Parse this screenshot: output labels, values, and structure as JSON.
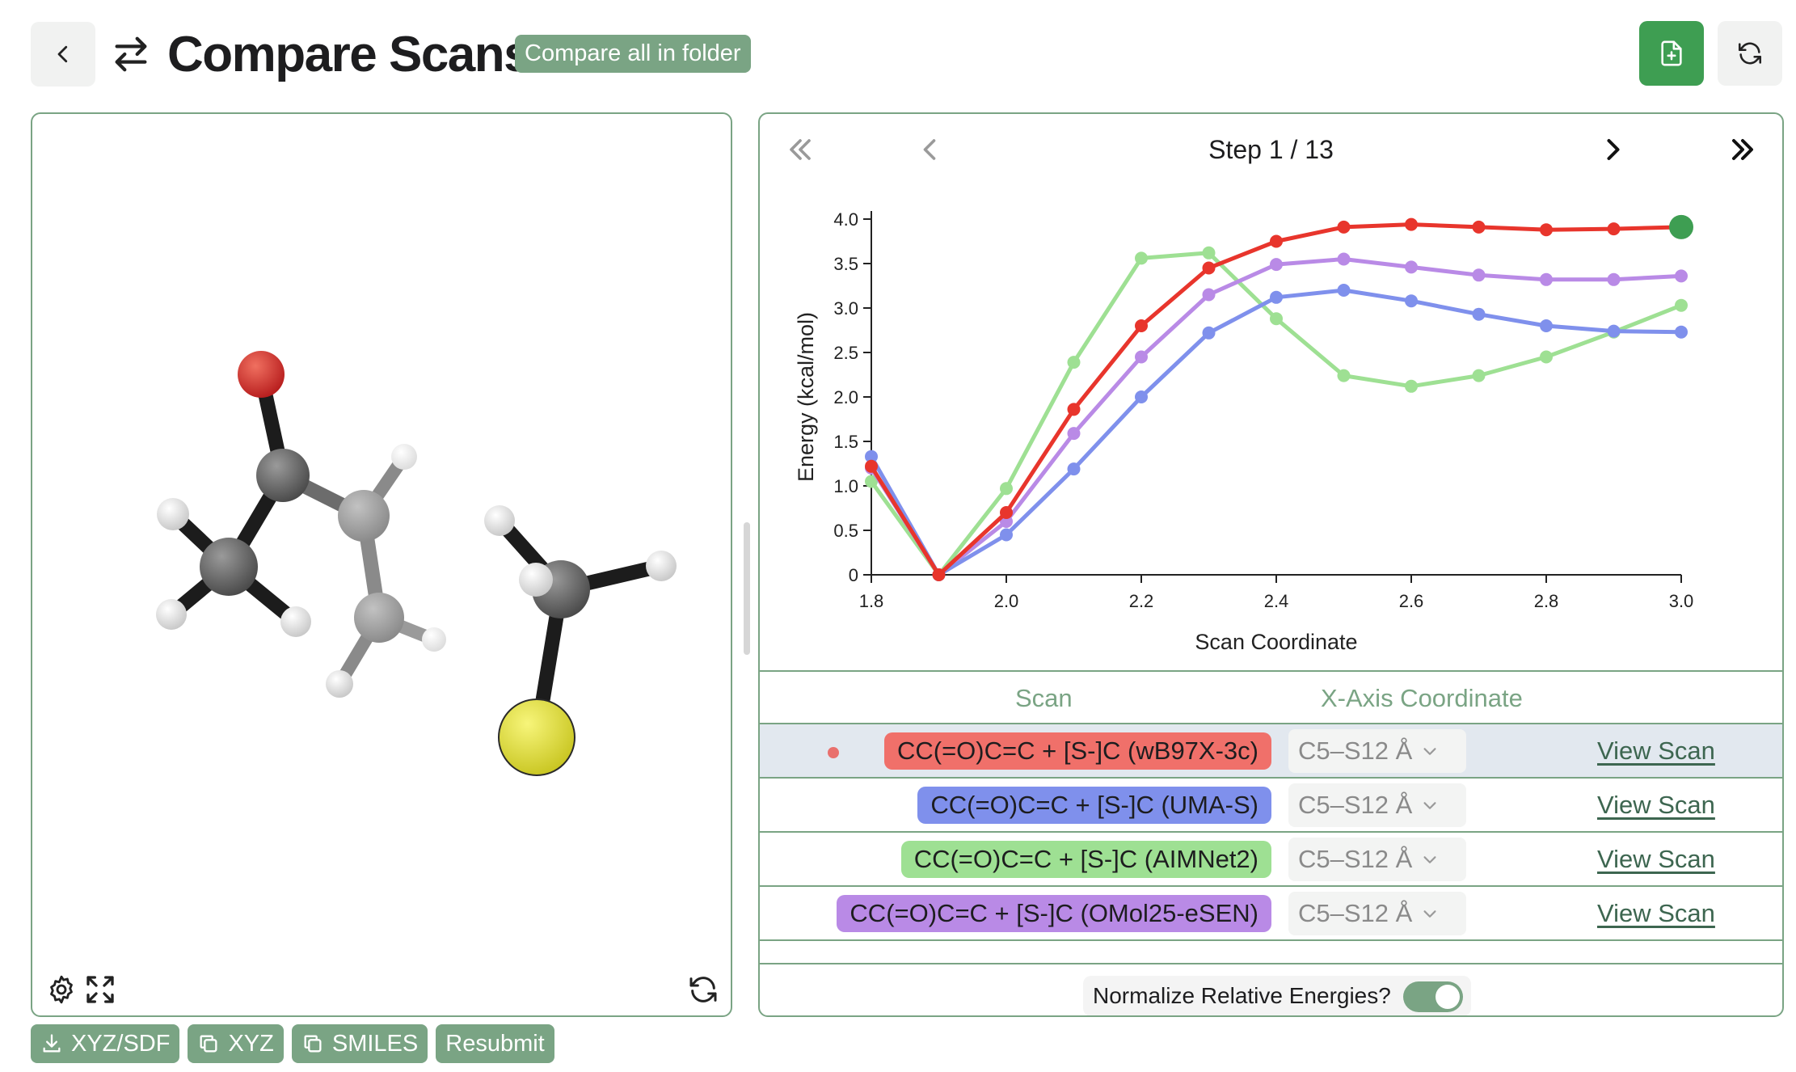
{
  "header": {
    "title": "Compare Scans",
    "folder_button": "Compare all in folder",
    "icons": [
      "chevron-left-icon",
      "swap-arrows-icon",
      "file-plus-icon",
      "refresh-icon"
    ]
  },
  "viewer": {
    "actions": [
      {
        "label": "XYZ/SDF",
        "icon": "download-icon"
      },
      {
        "label": "XYZ",
        "icon": "copy-icon"
      },
      {
        "label": "SMILES",
        "icon": "copy-icon"
      },
      {
        "label": "Resubmit",
        "icon": ""
      }
    ]
  },
  "stepper": {
    "label": "Step 1 / 13",
    "current_step": 1,
    "total_steps": 13
  },
  "chart_data": {
    "type": "line",
    "xlabel": "Scan Coordinate",
    "ylabel": "Energy (kcal/mol)",
    "xlim": [
      1.8,
      3.0
    ],
    "ylim": [
      0,
      4.0
    ],
    "x_ticks": [
      "1.8",
      "2.0",
      "2.2",
      "2.4",
      "2.6",
      "2.8",
      "3.0"
    ],
    "y_ticks": [
      "0",
      "0.5",
      "1.0",
      "1.5",
      "2.0",
      "2.5",
      "3.0",
      "3.5",
      "4.0"
    ],
    "x": [
      1.8,
      1.9,
      2.0,
      2.1,
      2.2,
      2.3,
      2.4,
      2.5,
      2.6,
      2.7,
      2.8,
      2.9,
      3.0
    ],
    "highlight_point": {
      "series": 0,
      "index": 12
    },
    "series": [
      {
        "color": "#e8352c",
        "values": [
          1.22,
          0.0,
          0.7,
          1.86,
          2.8,
          3.45,
          3.75,
          3.91,
          3.94,
          3.91,
          3.88,
          3.89,
          3.91
        ]
      },
      {
        "color": "#7f90ec",
        "values": [
          1.33,
          0.0,
          0.45,
          1.19,
          2.0,
          2.72,
          3.12,
          3.2,
          3.08,
          2.93,
          2.8,
          2.74,
          2.73
        ]
      },
      {
        "color": "#9ee093",
        "values": [
          1.05,
          0.0,
          0.97,
          2.39,
          3.56,
          3.62,
          2.88,
          2.24,
          2.12,
          2.24,
          2.45,
          2.73,
          3.03
        ]
      },
      {
        "color": "#b98ae6",
        "values": [
          1.2,
          0.0,
          0.6,
          1.59,
          2.45,
          3.15,
          3.49,
          3.55,
          3.46,
          3.37,
          3.32,
          3.32,
          3.36
        ]
      }
    ]
  },
  "table": {
    "headers": [
      "Scan",
      "X-Axis Coordinate"
    ],
    "rows": [
      {
        "name": "CC(=O)C=C + [S-]C (wB97X-3c)",
        "color": "#f0706a",
        "coord": "C5–S12 Å",
        "link": "View Scan",
        "selected": true
      },
      {
        "name": "CC(=O)C=C + [S-]C (UMA-S)",
        "color": "#7f90ec",
        "coord": "C5–S12 Å",
        "link": "View Scan",
        "selected": false
      },
      {
        "name": "CC(=O)C=C + [S-]C (AIMNet2)",
        "color": "#9ee093",
        "coord": "C5–S12 Å",
        "link": "View Scan",
        "selected": false
      },
      {
        "name": "CC(=O)C=C + [S-]C (OMol25-eSEN)",
        "color": "#b98ae6",
        "coord": "C5–S12 Å",
        "link": "View Scan",
        "selected": false
      }
    ]
  },
  "normalize": {
    "label": "Normalize Relative Energies?",
    "enabled": true
  }
}
